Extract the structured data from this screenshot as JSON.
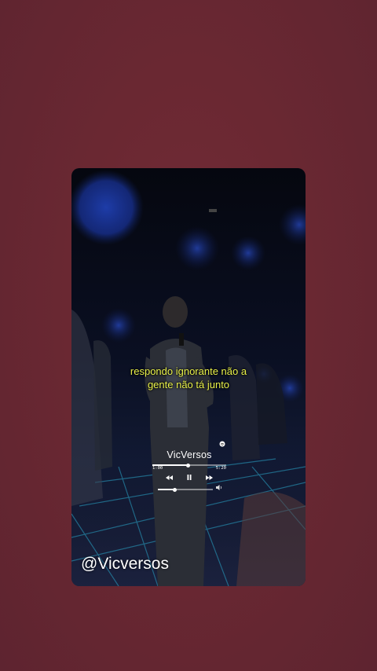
{
  "lyrics": {
    "line1": "respondo ignorante não a",
    "line2": "gente não tá junto"
  },
  "player": {
    "title": "VicVersos",
    "time_elapsed": "1:00",
    "time_total": "5:20",
    "progress": 0.48,
    "volume": 0.3,
    "icons": {
      "previous": "rewind-icon",
      "play_pause": "pause-icon",
      "next": "fast-forward-icon",
      "volume": "speaker-icon"
    }
  },
  "watermark": "@Vicversos",
  "colors": {
    "background": "#6a2832",
    "lyrics": "#e8f04a",
    "text": "#ffffff"
  }
}
